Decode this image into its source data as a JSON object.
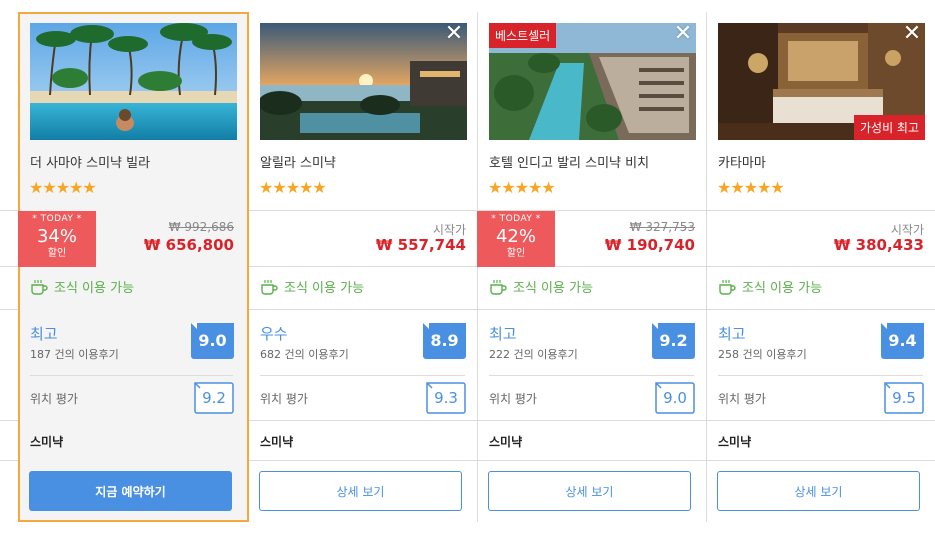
{
  "colors": {
    "accent": "#4a90e2",
    "sale": "#d8232a",
    "today_bg": "#ee5a5c",
    "stars": "#f6a623",
    "breakfast": "#5aaf4b",
    "selected_border": "#f3a93c"
  },
  "hotels": [
    {
      "name": "더 사마야 스미냑 빌라",
      "stars": "★★★★★",
      "today": {
        "label": "* TODAY *",
        "percent": "34%",
        "sub": "할인"
      },
      "original_price": "₩ 992,686",
      "price": "₩ 656,800",
      "breakfast": "조식 이용 가능",
      "score_label": "최고",
      "review_count": "187 건의 이용후기",
      "score": "9.0",
      "location_label": "위치 평가",
      "location_score": "9.2",
      "area": "스미냑",
      "button": "지금 예약하기"
    },
    {
      "name": "알릴라 스미냑",
      "stars": "★★★★★",
      "close_icon": "✕",
      "price_from": "시작가",
      "price": "₩ 557,744",
      "breakfast": "조식 이용 가능",
      "score_label": "우수",
      "review_count": "682 건의 이용후기",
      "score": "8.9",
      "location_label": "위치 평가",
      "location_score": "9.3",
      "area": "스미냑",
      "button": "상세 보기"
    },
    {
      "name": "호텔 인디고 발리 스미냑 비치",
      "stars": "★★★★★",
      "close_icon": "✕",
      "badge_top": "베스트셀러",
      "today": {
        "label": "* TODAY *",
        "percent": "42%",
        "sub": "할인"
      },
      "original_price": "₩ 327,753",
      "price": "₩ 190,740",
      "breakfast": "조식 이용 가능",
      "score_label": "최고",
      "review_count": "222 건의 이용후기",
      "score": "9.2",
      "location_label": "위치 평가",
      "location_score": "9.0",
      "area": "스미냑",
      "button": "상세 보기"
    },
    {
      "name": "카타마마",
      "stars": "★★★★★",
      "close_icon": "✕",
      "badge_bottom": "가성비 최고",
      "price_from": "시작가",
      "price": "₩ 380,433",
      "breakfast": "조식 이용 가능",
      "score_label": "최고",
      "review_count": "258 건의 이용후기",
      "score": "9.4",
      "location_label": "위치 평가",
      "location_score": "9.5",
      "area": "스미냑",
      "button": "상세 보기"
    }
  ]
}
